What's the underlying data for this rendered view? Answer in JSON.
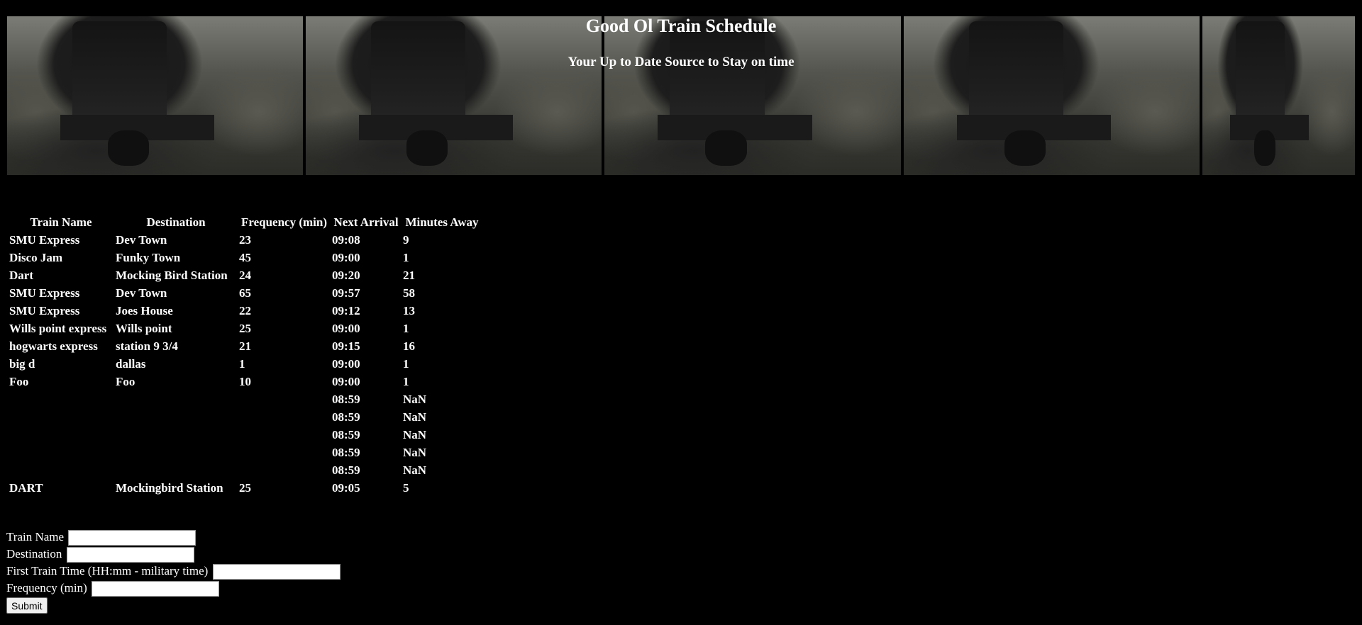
{
  "header": {
    "title": "Good Ol Train Schedule",
    "subtitle": "Your Up to Date Source to Stay on time",
    "banner_image": "steam-locomotive-filmstrip"
  },
  "table": {
    "columns": [
      "Train Name",
      "Destination",
      "Frequency (min)",
      "Next Arrival",
      "Minutes Away"
    ],
    "rows": [
      [
        "SMU Express",
        "Dev Town",
        "23",
        "09:08",
        "9"
      ],
      [
        "Disco Jam",
        "Funky Town",
        "45",
        "09:00",
        "1"
      ],
      [
        "Dart",
        "Mocking Bird Station",
        "24",
        "09:20",
        "21"
      ],
      [
        "SMU Express",
        "Dev Town",
        "65",
        "09:57",
        "58"
      ],
      [
        "SMU Express",
        "Joes House",
        "22",
        "09:12",
        "13"
      ],
      [
        "Wills point express",
        "Wills point",
        "25",
        "09:00",
        "1"
      ],
      [
        "hogwarts express",
        "station 9 3/4",
        "21",
        "09:15",
        "16"
      ],
      [
        "big d",
        "dallas",
        "1",
        "09:00",
        "1"
      ],
      [
        "Foo",
        "Foo",
        "10",
        "09:00",
        "1"
      ],
      [
        "",
        "",
        "",
        "08:59",
        "NaN"
      ],
      [
        "",
        "",
        "",
        "08:59",
        "NaN"
      ],
      [
        "",
        "",
        "",
        "08:59",
        "NaN"
      ],
      [
        "",
        "",
        "",
        "08:59",
        "NaN"
      ],
      [
        "",
        "",
        "",
        "08:59",
        "NaN"
      ],
      [
        "DART",
        "Mockingbird Station",
        "25",
        "09:05",
        "5"
      ]
    ]
  },
  "form": {
    "train_name_label": "Train Name",
    "train_name_value": "",
    "destination_label": "Destination",
    "destination_value": "",
    "first_time_label": "First Train Time (HH:mm - military time)",
    "first_time_value": "",
    "frequency_label": "Frequency (min)",
    "frequency_value": "",
    "submit_label": "Submit"
  }
}
